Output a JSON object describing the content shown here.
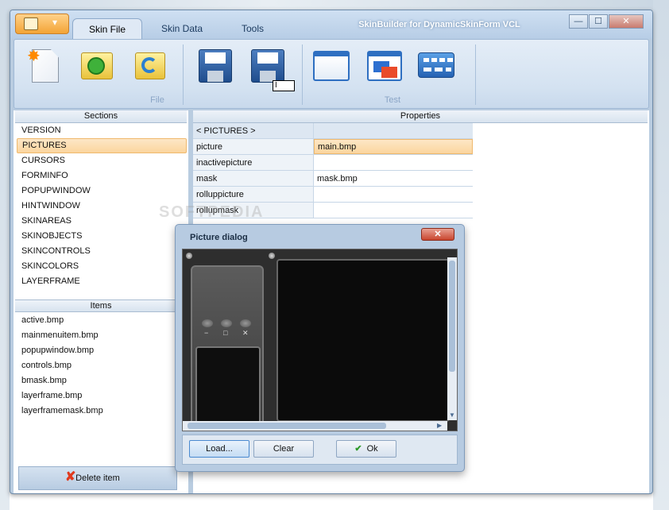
{
  "window": {
    "title": "SkinBuilder for DynamicSkinForm VCL",
    "tabs": [
      "Skin File",
      "Skin Data",
      "Tools"
    ],
    "controls": {
      "minimize": "—",
      "maximize": "☐",
      "close": "✕"
    }
  },
  "ribbon": {
    "groups": {
      "file": "File",
      "test": "Test"
    },
    "buttons": [
      "new-icon",
      "open-icon",
      "reload-icon",
      "save-icon",
      "save-as-icon",
      "form-preview-icon",
      "dialog-preview-icon",
      "controls-preview-icon"
    ],
    "cursor_label": "I"
  },
  "sections": {
    "header": "Sections",
    "items": [
      "VERSION",
      "PICTURES",
      "CURSORS",
      "FORMINFO",
      "POPUPWINDOW",
      "HINTWINDOW",
      "SKINAREAS",
      "SKINOBJECTS",
      "SKINCONTROLS",
      "SKINCOLORS",
      "LAYERFRAME"
    ],
    "selected": "PICTURES"
  },
  "items": {
    "header": "Items",
    "list": [
      "active.bmp",
      "mainmenuitem.bmp",
      "popupwindow.bmp",
      "controls.bmp",
      "bmask.bmp",
      "layerframe.bmp",
      "layerframemask.bmp"
    ]
  },
  "delete_button": "Delete item",
  "properties": {
    "header": "Properties",
    "rows": [
      {
        "name": "< PICTURES >",
        "value": ""
      },
      {
        "name": "picture",
        "value": "main.bmp"
      },
      {
        "name": "inactivepicture",
        "value": ""
      },
      {
        "name": "mask",
        "value": "mask.bmp"
      },
      {
        "name": "rolluppicture",
        "value": ""
      },
      {
        "name": "rollupmask",
        "value": ""
      }
    ]
  },
  "dialog": {
    "title": "Picture dialog",
    "close": "✕",
    "buttons": {
      "load": "Load...",
      "clear": "Clear",
      "ok": "Ok"
    },
    "skin_glyphs": [
      "−",
      "□",
      "✕"
    ]
  },
  "watermark": "SOFTPEDIA",
  "colors": {
    "accent": "#f3a436",
    "selection": "#fbd59e",
    "frame": "#b9cce0"
  }
}
